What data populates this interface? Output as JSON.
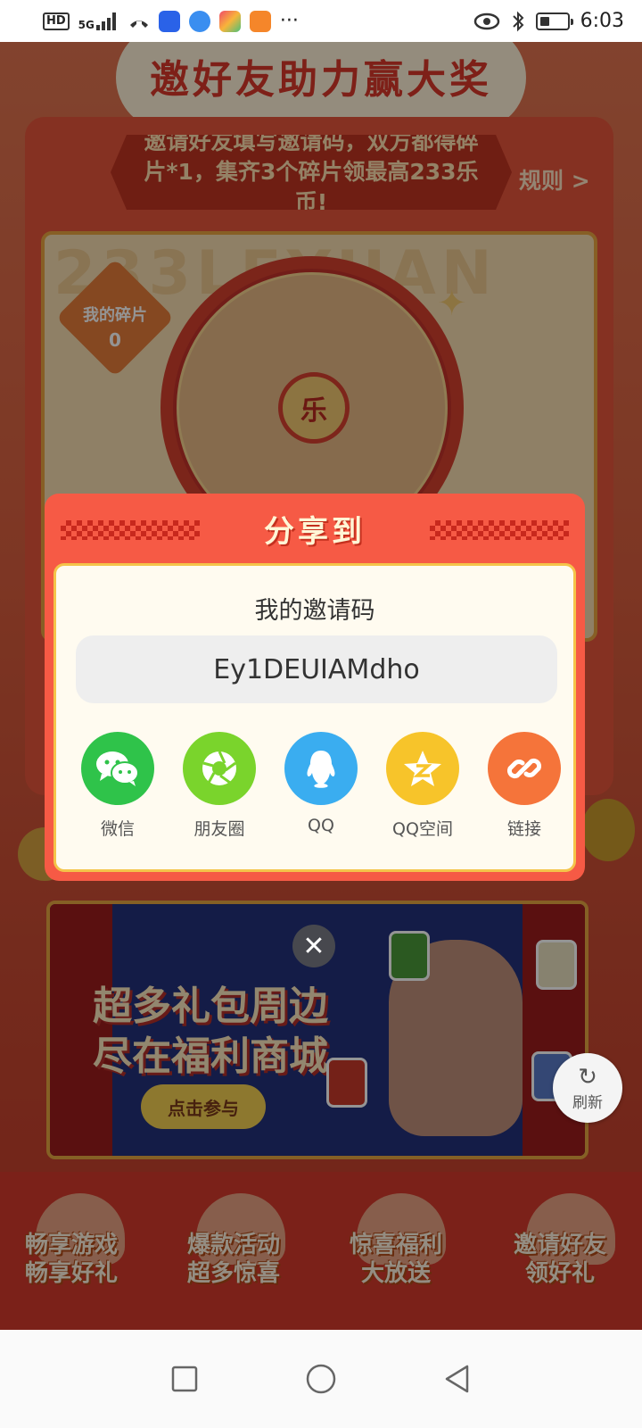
{
  "status_bar": {
    "network_badge": "HD",
    "signal_label": "5G",
    "time": "6:03",
    "overflow": "···",
    "icons": [
      "hd-badge-icon",
      "signal-icon",
      "missed-call-icon",
      "app-notification-icon",
      "eye-icon",
      "bluetooth-icon",
      "battery-icon"
    ]
  },
  "background_page": {
    "title": "邀好友助力赢大奖",
    "notice": "邀请好友填写邀请码，双方都得碎片*1，集齐3个碎片领最高233乐币!",
    "rules_link": "规则 >",
    "watermark": "233LEYUAN",
    "shard_label": "我的碎片",
    "shard_count": "0",
    "wheel_center": "乐",
    "mall_title_line1": "超多礼包周边",
    "mall_title_line2": "尽在福利商城",
    "mall_button": "点击参与",
    "refresh_label": "刷新",
    "features": [
      {
        "line1": "畅享游戏",
        "line2": "畅享好礼"
      },
      {
        "line1": "爆款活动",
        "line2": "超多惊喜"
      },
      {
        "line1": "惊喜福利",
        "line2": "大放送"
      },
      {
        "line1": "邀请好友",
        "line2": "领好礼"
      }
    ]
  },
  "share_modal": {
    "title": "分享到",
    "invite_label": "我的邀请码",
    "invite_code": "Ey1DEUIAMdho",
    "options": [
      {
        "label": "微信",
        "icon": "wechat-icon",
        "color": "#2fc34a"
      },
      {
        "label": "朋友圈",
        "icon": "moments-icon",
        "color": "#7ad42c"
      },
      {
        "label": "QQ",
        "icon": "qq-icon",
        "color": "#3aadf0"
      },
      {
        "label": "QQ空间",
        "icon": "qzone-icon",
        "color": "#f7c42a"
      },
      {
        "label": "链接",
        "icon": "link-icon",
        "color": "#f5743a"
      }
    ],
    "close_glyph": "✕"
  },
  "nav_bar": {
    "buttons": [
      "recent-apps",
      "home",
      "back"
    ]
  },
  "colors": {
    "modal_frame": "#f65a45",
    "modal_body": "#fffbf0",
    "accent_gold": "#f4c44a"
  }
}
